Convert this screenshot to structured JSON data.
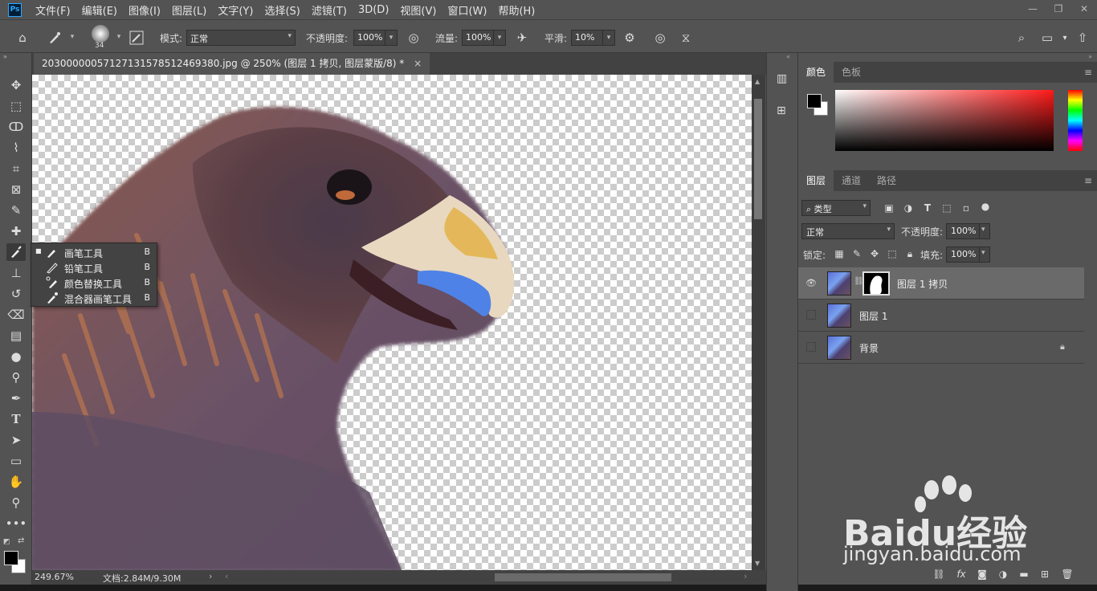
{
  "app": {
    "logo": "Ps"
  },
  "menu": [
    "文件(F)",
    "编辑(E)",
    "图像(I)",
    "图层(L)",
    "文字(Y)",
    "选择(S)",
    "滤镜(T)",
    "3D(D)",
    "视图(V)",
    "窗口(W)",
    "帮助(H)"
  ],
  "options": {
    "brush_size": "34",
    "mode_label": "模式:",
    "mode_value": "正常",
    "opacity_label": "不透明度:",
    "opacity_value": "100%",
    "flow_label": "流量:",
    "flow_value": "100%",
    "smoothing_label": "平滑:",
    "smoothing_value": "10%"
  },
  "document": {
    "tab_title": "20300000057127131578512469380.jpg @ 250% (图层 1 拷贝, 图层蒙版/8) *",
    "close_glyph": "×",
    "zoom": "249.67%",
    "doc_info": "文档:2.84M/9.30M"
  },
  "tool_flyout": [
    {
      "label": "画笔工具",
      "key": "B",
      "icon": "brush-icon",
      "active": true
    },
    {
      "label": "铅笔工具",
      "key": "B",
      "icon": "pencil-icon",
      "active": false
    },
    {
      "label": "颜色替换工具",
      "key": "B",
      "icon": "color-replace-icon",
      "active": false
    },
    {
      "label": "混合器画笔工具",
      "key": "B",
      "icon": "mixer-brush-icon",
      "active": false
    }
  ],
  "color_panel": {
    "tabs": [
      "颜色",
      "色板"
    ],
    "foreground": "#000000",
    "background": "#ffffff"
  },
  "layers_panel": {
    "tabs": [
      "图层",
      "通道",
      "路径"
    ],
    "filter_label": "类型",
    "blend_mode": "正常",
    "opacity_label": "不透明度:",
    "opacity_value": "100%",
    "lock_label": "锁定:",
    "fill_label": "填充:",
    "fill_value": "100%",
    "layers": [
      {
        "name": "图层 1 拷贝",
        "visible": true,
        "selected": true,
        "has_mask": true,
        "locked": false
      },
      {
        "name": "图层 1",
        "visible": false,
        "selected": false,
        "has_mask": false,
        "locked": false
      },
      {
        "name": "背景",
        "visible": false,
        "selected": false,
        "has_mask": false,
        "locked": true
      }
    ]
  },
  "watermark": {
    "line1": "Baidu经验",
    "line2": "jingyan.baidu.com"
  }
}
